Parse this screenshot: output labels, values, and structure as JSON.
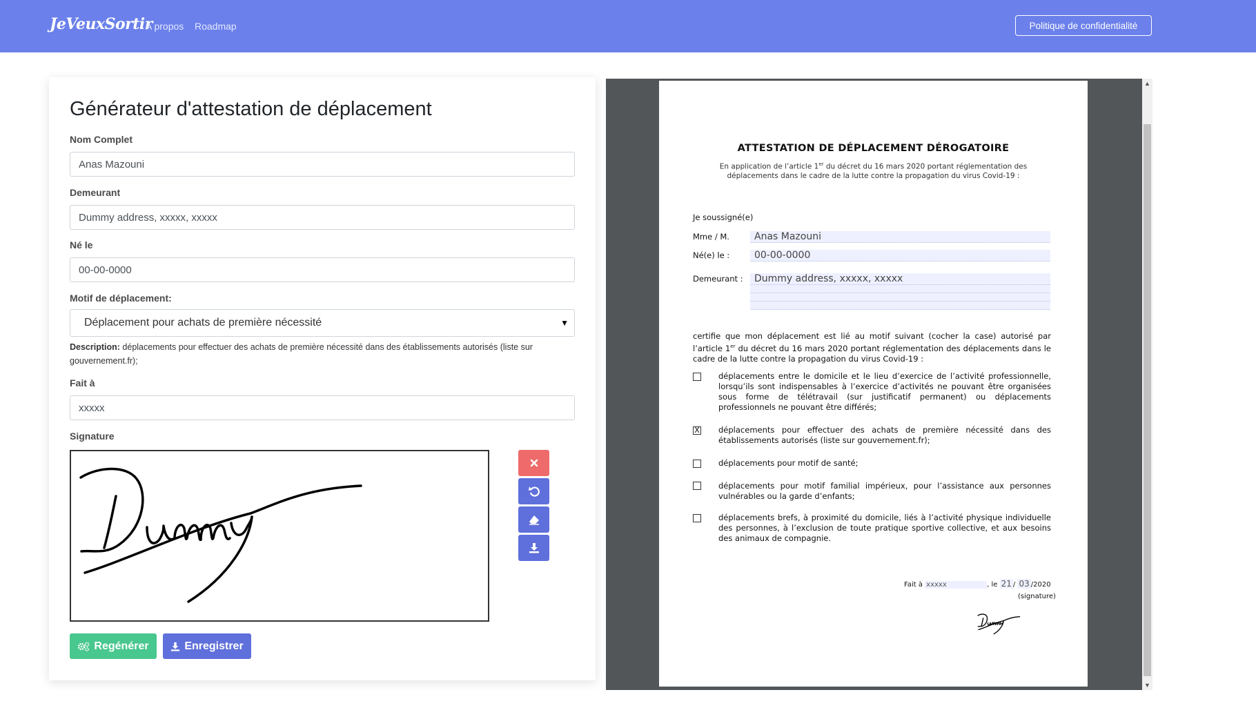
{
  "nav": {
    "brand": "JeVeuxSortir",
    "links": [
      "A propos",
      "Roadmap"
    ],
    "privacy_button": "Politique de confidentialité"
  },
  "form": {
    "title": "Générateur d'attestation de déplacement",
    "name_label": "Nom Complet",
    "name_value": "Anas Mazouni",
    "address_label": "Demeurant",
    "address_value": "Dummy address, xxxxx, xxxxx",
    "birth_label": "Né le",
    "birth_value": "00-00-0000",
    "reason_label": "Motif de déplacement:",
    "reason_value": "Déplacement pour achats de première nécessité",
    "description_label": "Description:",
    "description_text": "déplacements pour effectuer des achats de première nécessité dans des établissements autorisés (liste sur gouvernement.fr);",
    "place_label": "Fait à",
    "place_value": "xxxxx",
    "signature_label": "Signature",
    "signature_text": "Dummy",
    "regen_button": "Regénérer",
    "save_button": "Enregistrer"
  },
  "document": {
    "title": "ATTESTATION DE DÉPLACEMENT DÉROGATOIRE",
    "subtitle_a": "En application de l’article 1",
    "subtitle_sup": "er",
    "subtitle_b": " du décret du 16 mars 2020 portant réglementation des déplacements dans le cadre de la lutte contre la propagation du virus Covid-19 :",
    "soussigne": "Je soussigné(e)",
    "mme_label": "Mme / M.",
    "name": "Anas Mazouni",
    "birth_label": "Né(e) le :",
    "birth": "00-00-0000",
    "address_label": "Demeurant :",
    "address": "Dummy address, xxxxx, xxxxx",
    "certifie_a": "certifie que mon déplacement est lié au motif suivant (cocher la case) autorisé par l’article 1",
    "certifie_sup": "er",
    "certifie_b": " du décret du 16 mars 2020 portant réglementation des déplacements dans le cadre de la lutte contre la propagation du virus Covid-19 :",
    "options": [
      {
        "text": "déplacements entre le domicile et le lieu d’exercice de l’activité professionnelle, lorsqu’ils sont indispensables à l’exercice d’activités ne pouvant être organisées sous forme de télétravail (sur justificatif permanent) ou déplacements professionnels ne pouvant être différés;",
        "mark": ""
      },
      {
        "text": "déplacements pour effectuer des achats de première nécessité dans des établissements autorisés (liste sur gouvernement.fr);",
        "mark": "X"
      },
      {
        "text": "déplacements pour motif de santé;",
        "mark": ""
      },
      {
        "text": "déplacements pour motif familial impérieux, pour l’assistance aux personnes vulnérables ou la garde d’enfants;",
        "mark": ""
      },
      {
        "text": "déplacements brefs, à proximité du domicile, liés à l’activité physique individuelle des personnes, à l’exclusion de toute pratique sportive collective, et aux besoins des animaux de compagnie.",
        "mark": ""
      }
    ],
    "fait_label": "Fait à",
    "fait_place": "xxxxx",
    "le_label": ", le",
    "day": "21",
    "month": "03",
    "year": "/2020",
    "signature_label": "(signature)"
  }
}
